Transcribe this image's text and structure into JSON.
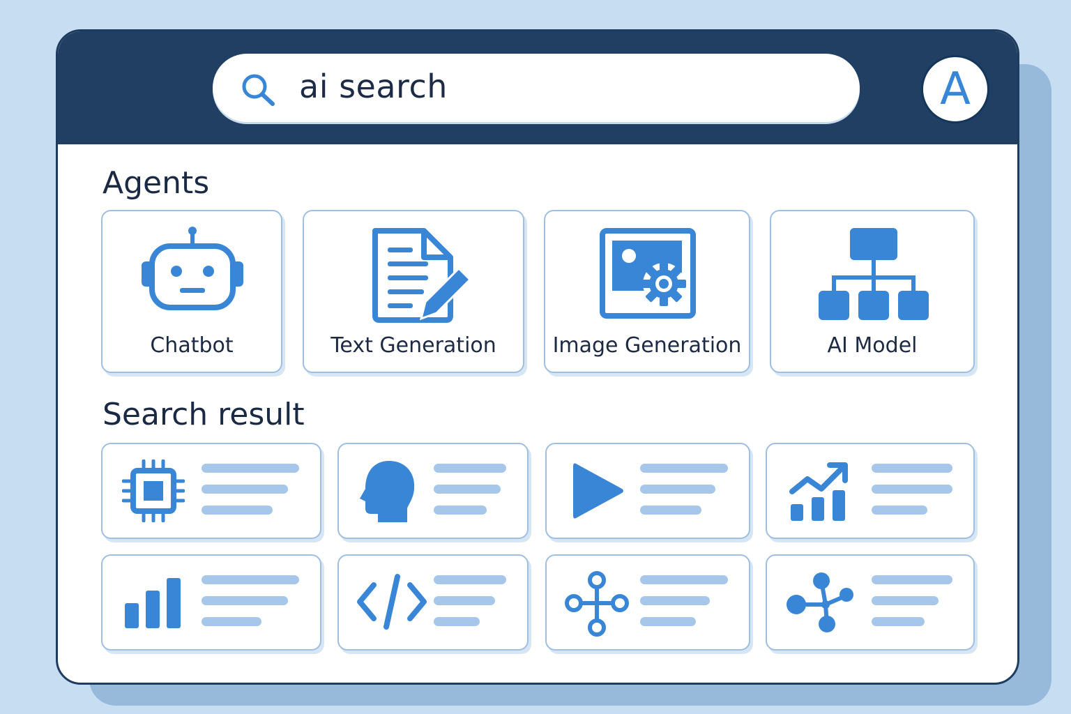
{
  "search": {
    "query": "ai search",
    "icon": "search-icon"
  },
  "user": {
    "avatar_letter": "A"
  },
  "agents": {
    "title": "Agents",
    "items": [
      {
        "label": "Chatbot",
        "icon": "robot-icon"
      },
      {
        "label": "Text Generation",
        "icon": "document-pencil-icon"
      },
      {
        "label": "Image Generation",
        "icon": "image-gear-icon"
      },
      {
        "label": "AI Model",
        "icon": "hierarchy-icon"
      }
    ]
  },
  "results": {
    "title": "Search result",
    "items": [
      {
        "icon": "chip-icon"
      },
      {
        "icon": "head-icon"
      },
      {
        "icon": "play-icon"
      },
      {
        "icon": "trend-chart-icon"
      },
      {
        "icon": "bar-chart-icon"
      },
      {
        "icon": "code-icon"
      },
      {
        "icon": "share-nodes-icon"
      },
      {
        "icon": "network-icon"
      }
    ]
  },
  "colors": {
    "background": "#c7def2",
    "header": "#203f63",
    "accent": "#3a86d6",
    "placeholder_line": "#a6c7e9"
  }
}
